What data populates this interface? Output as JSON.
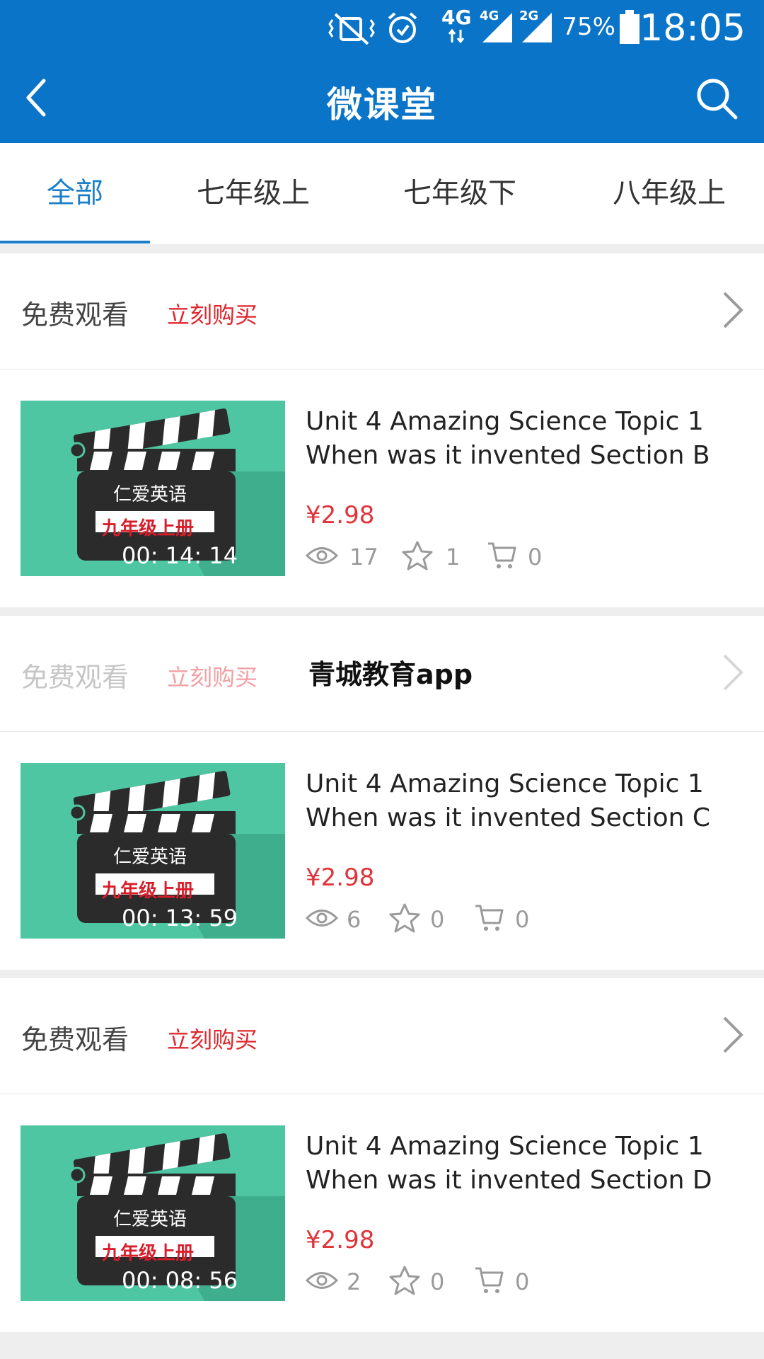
{
  "status_bar": {
    "network_1": "4G",
    "network_2": "4G",
    "network_3": "2G",
    "battery": "75%",
    "time": "18:05"
  },
  "header": {
    "title": "微课堂"
  },
  "tabs": [
    {
      "label": "全部",
      "active": true
    },
    {
      "label": "七年级上",
      "active": false
    },
    {
      "label": "七年级下",
      "active": false
    },
    {
      "label": "八年级上",
      "active": false
    }
  ],
  "courses": [
    {
      "free_label": "免费观看",
      "buy_label": "立刻购买",
      "thumb_brand": "仁爱英语",
      "thumb_grade": "九年级上册",
      "duration": "00: 14: 14",
      "title_line1": "Unit 4 Amazing Science Topic 1",
      "title_line2": "When was it invented Section B",
      "price": "¥2.98",
      "views": "17",
      "favorites": "1",
      "cart": "0"
    },
    {
      "free_label": "免费观看",
      "buy_label": "立刻购买",
      "watermark": "青城教育app",
      "thumb_brand": "仁爱英语",
      "thumb_grade": "九年级上册",
      "duration": "00: 13: 59",
      "title_line1": "Unit 4 Amazing Science Topic 1",
      "title_line2": "When was it invented Section C",
      "price": "¥2.98",
      "views": "6",
      "favorites": "0",
      "cart": "0"
    },
    {
      "free_label": "免费观看",
      "buy_label": "立刻购买",
      "thumb_brand": "仁爱英语",
      "thumb_grade": "九年级上册",
      "duration": "00: 08: 56",
      "title_line1": "Unit 4 Amazing Science Topic 1",
      "title_line2": "When was it invented Section D",
      "price": "¥2.98",
      "views": "2",
      "favorites": "0",
      "cart": "0"
    }
  ],
  "colors": {
    "primary": "#0a74c8",
    "accent_red": "#e0262d",
    "tab_active": "#1b7fc9",
    "thumb_green": "#4fc6a2"
  }
}
